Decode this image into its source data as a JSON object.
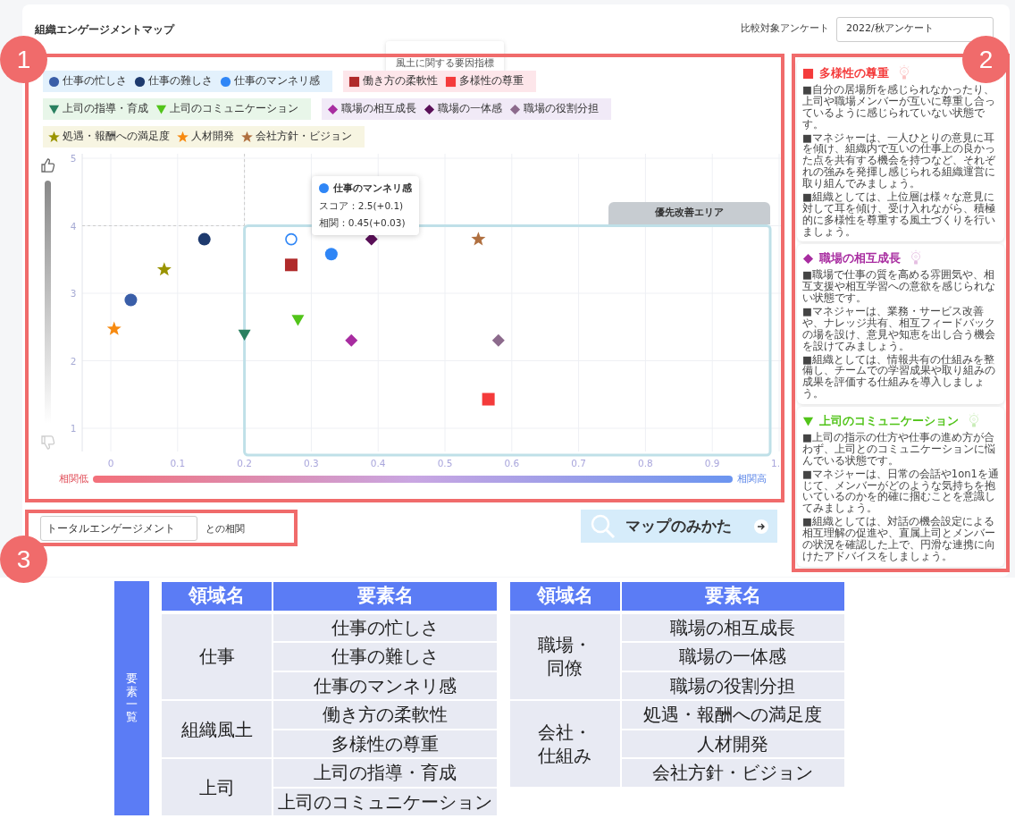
{
  "title": "組織エンゲージメントマップ",
  "compare": {
    "label": "比較対象アンケート",
    "value": "2022/秋アンケート"
  },
  "indicator_label": "風土に関する要因指標",
  "callouts": [
    {
      "number": "1"
    },
    {
      "number": "2"
    },
    {
      "number": "3"
    }
  ],
  "legend": [
    {
      "groups": [
        {
          "color": "#e3f1fc",
          "items": [
            {
              "label": "仕事の忙しさ",
              "kind": "circle",
              "color": "#3a5ea8"
            },
            {
              "label": "仕事の難しさ",
              "kind": "circle",
              "color": "#1e3a6e"
            },
            {
              "label": "仕事のマンネリ感",
              "kind": "circle",
              "color": "#2f86f6"
            }
          ]
        },
        {
          "color": "#fde6ea",
          "items": [
            {
              "label": "働き方の柔軟性",
              "kind": "square",
              "color": "#b02a2a"
            },
            {
              "label": "多様性の尊重",
              "kind": "square",
              "color": "#f43b3b"
            }
          ]
        }
      ]
    },
    {
      "groups": [
        {
          "color": "#e8f6e9",
          "items": [
            {
              "label": "上司の指導・育成",
              "kind": "triangle",
              "color": "#2a8060"
            },
            {
              "label": "上司のコミュニケーション",
              "kind": "triangle",
              "color": "#52c41a"
            }
          ]
        },
        {
          "color": "#f1eaf7",
          "items": [
            {
              "label": "職場の相互成長",
              "kind": "diamond",
              "color": "#a82ca0"
            },
            {
              "label": "職場の一体感",
              "kind": "diamond",
              "color": "#5a1058"
            },
            {
              "label": "職場の役割分担",
              "kind": "diamond",
              "color": "#8c6a8c"
            }
          ]
        }
      ]
    },
    {
      "groups": [
        {
          "color": "#f7f5e2",
          "items": [
            {
              "label": "処遇・報酬への満足度",
              "kind": "star",
              "color": "#9a9400"
            },
            {
              "label": "人材開発",
              "kind": "star",
              "color": "#f78a10"
            },
            {
              "label": "会社方針・ビジョン",
              "kind": "star",
              "color": "#b07040"
            }
          ]
        }
      ]
    }
  ],
  "chart": {
    "chart_data": {
      "type": "scatter",
      "grid": true,
      "xlim": [
        0,
        1
      ],
      "ylim": [
        1,
        5
      ],
      "ref_lines": [
        {
          "axis": "x",
          "value": 0.2
        },
        {
          "axis": "y",
          "value": 4
        }
      ],
      "xticks": [
        0,
        0.1,
        0.2,
        0.3,
        0.4,
        0.5,
        0.6,
        0.7,
        0.8,
        0.9,
        {
          "value": 1,
          "label": "1."
        }
      ],
      "yticks": [
        1,
        2,
        3,
        4,
        5
      ],
      "series": [
        {
          "color": "#3a5ea8",
          "x": [
            0.03
          ],
          "values": [
            2.9
          ]
        },
        {
          "color": "#1e3a6e",
          "x": [
            0.14
          ],
          "values": [
            3.8
          ]
        },
        {
          "color": "#2f86f6",
          "x": [
            0.33
          ],
          "values": [
            3.58
          ]
        },
        {
          "color": "#b02a2a",
          "x": [
            0.27
          ],
          "values": [
            3.42
          ]
        },
        {
          "color": "#f43b3b",
          "x": [
            0.565
          ],
          "values": [
            1.43
          ]
        },
        {
          "color": "#2a8060",
          "x": [
            0.2
          ],
          "values": [
            2.38
          ]
        },
        {
          "color": "#52c41a",
          "x": [
            0.28
          ],
          "values": [
            2.6
          ]
        },
        {
          "color": "#a82ca0",
          "x": [
            0.36
          ],
          "values": [
            2.3
          ]
        },
        {
          "color": "#5a1058",
          "x": [
            0.39
          ],
          "values": [
            3.8
          ]
        },
        {
          "color": "#8c6a8c",
          "x": [
            0.58
          ],
          "values": [
            2.3
          ]
        },
        {
          "color": "#9a9400",
          "x": [
            0.08
          ],
          "values": [
            3.35
          ]
        },
        {
          "color": "#f78a10",
          "x": [
            0.005
          ],
          "values": [
            2.47
          ]
        },
        {
          "color": "#b07040",
          "x": [
            0.55
          ],
          "values": [
            3.8
          ]
        },
        {
          "color": "#2f86f6",
          "x": [
            0.27
          ],
          "values": [
            3.8
          ]
        }
      ]
    },
    "priority_area_label": "優先改善エリア",
    "tooltip": {
      "title": "仕事のマンネリ感",
      "lines": [
        "スコア：2.5(+0.1)",
        "相関：0.45(+0.03)"
      ]
    },
    "axis_low": "相関低",
    "axis_high": "相関高"
  },
  "correlation": {
    "value": "トータルエンゲージメント",
    "suffix": "との相関"
  },
  "guide_button": "マップのみかた",
  "advice_cards": [
    {
      "title": "多様性の尊重",
      "kind": "square",
      "color": "#f43b3b",
      "paragraphs": [
        "■自分の居場所を感じられなかったり、上司や職場メンバーが互いに尊重し合っているように感じられていない状態です。",
        "■マネジャーは、一人ひとりの意見に耳を傾け、組織内で互いの仕事上の良かった点を共有する機会を持つなど、それぞれの強みを発揮し感じられる組織運営に取り組んでみましょう。",
        "■組織としては、上位層は様々な意見に対して耳を傾け、受け入れながら、積極的に多様性を尊重する風土づくりを行いましょう。"
      ]
    },
    {
      "title": "職場の相互成長",
      "kind": "diamond",
      "color": "#a82ca0",
      "paragraphs": [
        "■職場で仕事の質を高める雰囲気や、相互支援や相互学習への意欲を感じられない状態です。",
        "■マネジャーは、業務・サービス改善や、ナレッジ共有、相互フィードバックの場を設け、意見や知恵を出し合う機会を設けてみましょう。",
        "■組織としては、情報共有の仕組みを整備し、チームでの学習成果や取り組みの成果を評価する仕組みを導入しましょう。"
      ]
    },
    {
      "title": "上司のコミュニケーション",
      "kind": "triangle",
      "color": "#52c41a",
      "paragraphs": [
        "■上司の指示の仕方や仕事の進め方が合わず、上司とのコミュニケーションに悩んでいる状態です。",
        "■マネジャーは、日常の会話や1on1を通じて、メンバーがどのような気持ちを抱いているのかを的確に掴むことを意識してみましょう。",
        "■組織としては、対話の機会設定による相互理解の促進や、直属上司とメンバーの状況を確認した上で、円滑な連携に向けたアドバイスをしましょう。"
      ]
    }
  ],
  "element_list": {
    "label": "要素一覧",
    "tables": [
      {
        "headers": [
          "領域名",
          "要素名"
        ],
        "groups": [
          {
            "domain": "仕事",
            "elements": [
              "仕事の忙しさ",
              "仕事の難しさ",
              "仕事のマンネリ感"
            ]
          },
          {
            "domain": "組織風土",
            "elements": [
              "働き方の柔軟性",
              "多様性の尊重"
            ]
          },
          {
            "domain": "上司",
            "elements": [
              "上司の指導・育成",
              "上司のコミュニケーション"
            ]
          }
        ]
      },
      {
        "headers": [
          "領域名",
          "要素名"
        ],
        "groups": [
          {
            "domain": "職場・同僚",
            "elements": [
              "職場の相互成長",
              "職場の一体感",
              "職場の役割分担"
            ]
          },
          {
            "domain": "会社・仕組み",
            "elements": [
              "処遇・報酬への満足度",
              "人材開発",
              "会社方針・ビジョン"
            ]
          }
        ]
      }
    ]
  }
}
